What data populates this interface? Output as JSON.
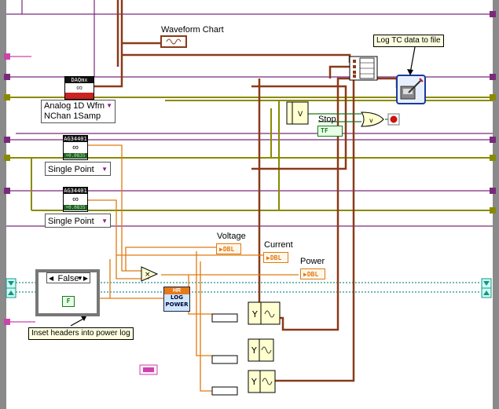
{
  "labels": {
    "waveform_chart": "Waveform Chart",
    "voltage": "Voltage",
    "current": "Current",
    "power": "Power",
    "stop": "Stop"
  },
  "annotations": {
    "log_tc": "Log TC data to file",
    "inset_headers": "Inset headers into power log"
  },
  "daqmx": {
    "header": "DAQmx",
    "polymorphic_line1": "Analog 1D Wfm",
    "polymorphic_line2": "NChan 1Samp"
  },
  "ag34401_a": {
    "header": "AG34401",
    "display": "+0.0835",
    "mode": "Single Point"
  },
  "ag34401_b": {
    "header": "AG34401",
    "display": "+0.0835",
    "mode": "Single Point"
  },
  "case_structure": {
    "selector": "False",
    "constant": "F"
  },
  "terminals": {
    "dbl": "DBL",
    "stop_tf": "TF"
  },
  "log_power": {
    "header": "HR",
    "line1": "LOG",
    "line2": "POWER"
  },
  "colors": {
    "orange_wire": "#e07a10",
    "pink_wire": "#cc44aa",
    "purple_wire": "#7a2a7a",
    "yellow_wire": "#8a8a00",
    "teal_wire": "#1a9090",
    "brown_wire": "#8a3a1a",
    "green_bool": "#1a7a1a"
  }
}
